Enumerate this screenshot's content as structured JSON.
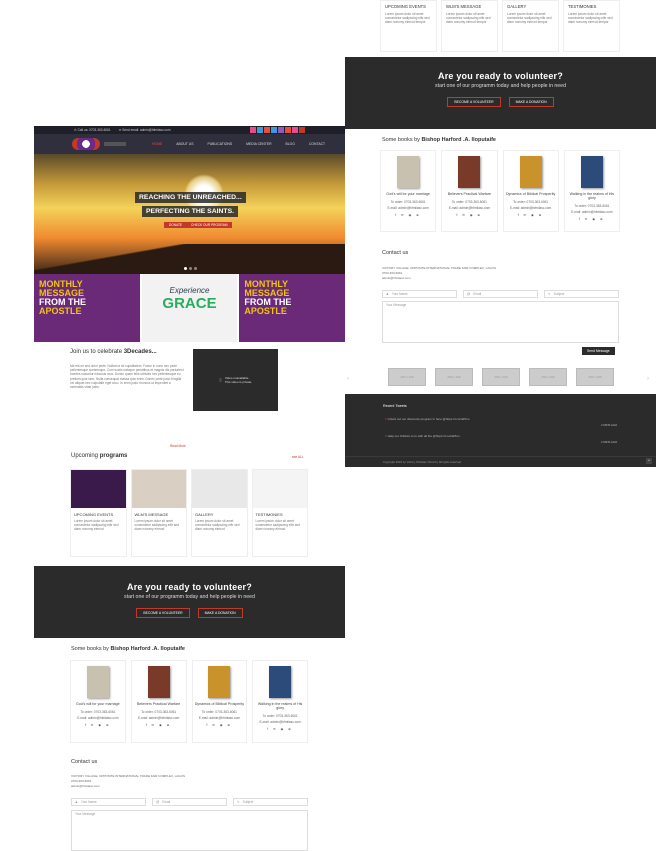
{
  "right_panel": {
    "cards": [
      {
        "title": "UPCOMING EVENTS",
        "text": "Lorem ipsum dolor sit amet consectetur sadipscing elitr sed diam nonumy eirmod tempor"
      },
      {
        "title": "WLM'S MESSAGE",
        "text": "Lorem ipsum dolor sit amet consectetur sadipscing elitr sed diam nonumy eirmod tempor"
      },
      {
        "title": "GALLERY",
        "text": "Lorem ipsum dolor sit amet consectetur sadipscing elitr sed diam nonumy eirmod tempor"
      },
      {
        "title": "TESTIMONIES",
        "text": "Lorem ipsum dolor sit amet consectetur sadipscing elitr sed diam nonumy eirmod tempor"
      }
    ],
    "volunteer": {
      "title": "Are you ready to volunteer?",
      "subtitle": "start one of our programm today and help people in need",
      "btn1": "BECOME A VOLUNTEER",
      "btn2": "MAKE A DONATION"
    },
    "books_title_prefix": "Some books by ",
    "books_title_bold": "Bishop Harford .A. Iloputaife",
    "books": [
      {
        "title": "God's will for your marriage",
        "order": "To order: 0703-363-6061",
        "email": "E-mail: admin@hfmiiasc.com",
        "color": "#c8c1b0"
      },
      {
        "title": "Believers Practical Warfare",
        "order": "To order: 0703-363-6061",
        "email": "E-mail: admin@hfmiiasc.com",
        "color": "#7a3a2a"
      },
      {
        "title": "Dynamics of Biblical Prosperity",
        "order": "To order: 0703-363-6061",
        "email": "E-mail: admin@hfmiiasc.com",
        "color": "#c9922a"
      },
      {
        "title": "Walking in the realms of His glory",
        "order": "To order: 0703-363-6061",
        "email": "E-mail: admin@hfmiiasc.com",
        "color": "#2c4a7a"
      }
    ],
    "contact": {
      "title": "Contact us",
      "address": "VICTORY VILLAGE, OPPOSITE INTERNATIONAL TRADE FAIR COMPLEX, LAGOS",
      "phone": "0703-363-6061",
      "email": "admin@hfmiiasc.com",
      "name_ph": "Your Name",
      "email_ph": "Email",
      "subject_ph": "Subject",
      "msg_ph": "Your Message",
      "send": "Send Message"
    },
    "ads": [
      "250 x 100",
      "250 x 100",
      "250 x 100",
      "250 x 100",
      "250 x 100"
    ],
    "tweets": {
      "title": "Recent Tweets",
      "t1": "Check out our discounts program in here @https://t.co/vkPkm",
      "t1_time": "2 MINS AGO",
      "t2": "Help our children to to with all the @https://t.co/vkPkm",
      "t2_time": "2 MINS AGO"
    },
    "footer": "Copyright 2015 by Victory Christian Church | All rights reserved"
  },
  "main_page": {
    "topbar": {
      "call": "Call us: 0703-363-6061",
      "email": "Send email: admin@hfmiiasc.com"
    },
    "nav": [
      "HOME",
      "ABOUT US",
      "PUBLICATIONS",
      "MEDIA CENTER",
      "BLOG",
      "CONTACT"
    ],
    "hero": {
      "line1": "REACHING THE UNREACHED...",
      "line2": "PERFECTING THE SAINTS.",
      "btn1": "DONATE",
      "btn2": "CHECK OUR PROGRAM"
    },
    "banners": [
      {
        "l1": "MONTHLY",
        "l2": "MESSAGE",
        "l3": "FROM THE",
        "l4": "APOSTLE"
      },
      {
        "l1": "Experience",
        "l2": "GRACE"
      },
      {
        "l1": "MONTHLY",
        "l2": "MESSAGE",
        "l3": "FROM THE",
        "l4": "APOSTLE"
      }
    ],
    "join": {
      "title_prefix": "Join us to celebrate ",
      "title_bold": "3Decades...",
      "text": "Ma est mi sed dolor pede. Nullam a sit cupiditatem. Fusce in nunc nec pede pellentesque scelerisque. Cum sociis natoque penatibus et magnis dis parturient montes nascetur ridiculus mus. Donec quam felis ultricies nec pellentesque eu pretium quis sem. Nulla consequat massa quis enim. Donec pede justo fringilla vel aliquet nec vulputate eget arcu. In enim justo rhoncus ut imperdiet a venenatis vitae justo.",
      "more": "Read More",
      "video1": "Video unavailable",
      "video2": "This video is private."
    },
    "programs": {
      "title_prefix": "Upcoming ",
      "title_bold": "programs",
      "all": "see ALL"
    },
    "cards": [
      {
        "title": "UPCOMING EVENTS",
        "text": "Lorem ipsum dolor sit amet consectetur sadipscing elitr sed diam nonumy eirmod",
        "color": "#3a1a4a"
      },
      {
        "title": "WLM'S MESSAGE",
        "text": "Lorem ipsum dolor sit amet consectetur sadipscing elitr sed diam nonumy eirmod",
        "color": "#d9cfc3"
      },
      {
        "title": "GALLERY",
        "text": "Lorem ipsum dolor sit amet consectetur sadipscing elitr sed diam nonumy eirmod",
        "color": "#e8e8e8"
      },
      {
        "title": "TESTIMONIES",
        "text": "Lorem ipsum dolor sit amet consectetur sadipscing elitr sed diam nonumy eirmod",
        "color": "#f4f4f4"
      }
    ],
    "volunteer": {
      "title": "Are you ready to volunteer?",
      "subtitle": "start one of our programm today and help people in need",
      "btn1": "BECOME A VOLUNTEER",
      "btn2": "MAKE A DONATION"
    },
    "books_title_prefix": "Some books by ",
    "books_title_bold": "Bishop Harford .A. Iloputaife",
    "books": [
      {
        "title": "God's will for your marriage",
        "order": "To order: 0703-363-6061",
        "email": "E-mail: admin@hfmiiasc.com",
        "color": "#c8c1b0"
      },
      {
        "title": "Believers Practical Warfare",
        "order": "To order: 0703-363-6061",
        "email": "E-mail: admin@hfmiiasc.com",
        "color": "#7a3a2a"
      },
      {
        "title": "Dynamics of Biblical Prosperity",
        "order": "To order: 0703-363-6061",
        "email": "E-mail: admin@hfmiiasc.com",
        "color": "#c9922a"
      },
      {
        "title": "Walking in the realms of His glory",
        "order": "To order: 0703-363-6061",
        "email": "E-mail: admin@hfmiiasc.com",
        "color": "#2c4a7a"
      }
    ],
    "contact": {
      "title": "Contact us",
      "address": "VICTORY VILLAGE, OPPOSITE INTERNATIONAL TRADE FAIR COMPLEX, LAGOS",
      "phone": "0703-363-6061",
      "email": "admin@hfmiiasc.com",
      "name_ph": "Your Name",
      "email_ph": "Email",
      "subject_ph": "Subject",
      "msg_ph": "Your Message"
    }
  }
}
